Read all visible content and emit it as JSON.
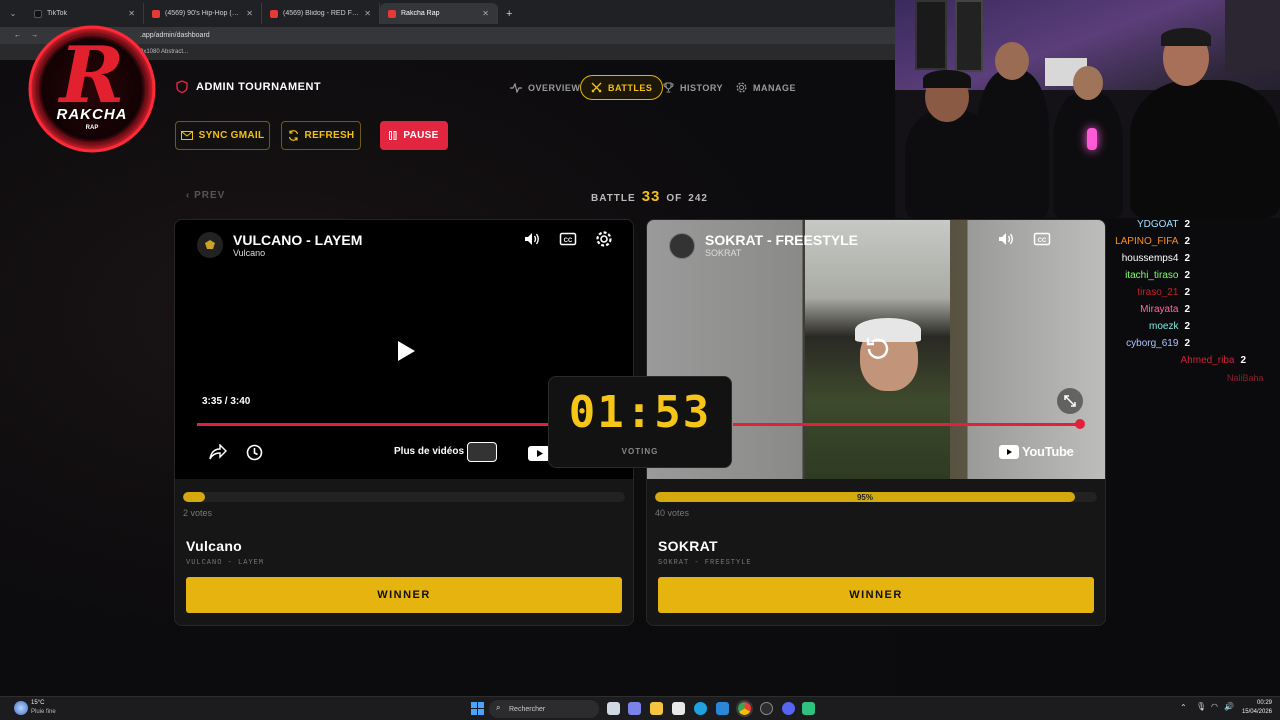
{
  "browser": {
    "tabs": [
      {
        "label": "TikTok",
        "color": "#111111",
        "active": false
      },
      {
        "label": "(4569) 90's Hip-Hop (1994) [Lo...",
        "color": "#e53935",
        "active": false
      },
      {
        "label": "(4569) Blidog - RED FLAG (Offi...",
        "color": "#e53935",
        "active": false
      },
      {
        "label": "Rakcha Rap",
        "color": "#e53935",
        "active": true
      }
    ],
    "new_tab": "+",
    "url": ".app/admin/dashboard",
    "bookmark": "0x1080 Abstract..."
  },
  "logo": {
    "text": "RAKCHA",
    "sub": "RAP",
    "letter": "R"
  },
  "header": {
    "title": "ADMIN TOURNAMENT",
    "nav": [
      {
        "label": "OVERVIEW",
        "icon": "activity-icon"
      },
      {
        "label": "BATTLES",
        "icon": "swords-icon"
      },
      {
        "label": "HISTORY",
        "icon": "trophy-icon"
      },
      {
        "label": "MANAGE",
        "icon": "gear-icon"
      }
    ]
  },
  "actions": {
    "sync": "SYNC GMAIL",
    "refresh": "REFRESH",
    "pause": "PAUSE"
  },
  "battle": {
    "prev": "PREV",
    "label": "BATTLE",
    "current": "33",
    "of": "OF",
    "total": "242"
  },
  "left": {
    "video_title": "VULCANO - LAYEM",
    "channel": "Vulcano",
    "time": "3:35 / 3:40",
    "more": "Plus de vidéos",
    "vote_pct": 5,
    "vote_label": "",
    "votes": "2 votes",
    "name": "Vulcano",
    "sub": "VULCANO - LAYEM",
    "winner": "WINNER"
  },
  "right": {
    "video_title": "SOKRAT - FREESTYLE",
    "channel": "SOKRAT",
    "youtube": "YouTube",
    "vote_pct": 95,
    "vote_label": "95%",
    "votes": "40 votes",
    "name": "SOKRAT",
    "sub": "SOKRAT - FREESTYLE",
    "winner": "WINNER"
  },
  "timer": {
    "value": "01:53",
    "label": "VOTING"
  },
  "chat": [
    {
      "user": "YDGOAT",
      "count": "2",
      "color": "#9fe0ff"
    },
    {
      "user": "LAPINO_FIFA",
      "count": "2",
      "color": "#ff8c1a"
    },
    {
      "user": "houssemps4",
      "count": "2",
      "color": "#ffffff"
    },
    {
      "user": "itachi_tiraso",
      "count": "2",
      "color": "#7cff6a"
    },
    {
      "user": "tiraso_21",
      "count": "2",
      "color": "#c0202a"
    },
    {
      "user": "Mirayata",
      "count": "2",
      "color": "#ff6b9a"
    },
    {
      "user": "moezk",
      "count": "2",
      "color": "#7ee8e0"
    },
    {
      "user": "cyborg_619",
      "count": "2",
      "color": "#b0c4ff"
    },
    {
      "user": "Ahmed_riba",
      "count": "2",
      "color": "#d0203a"
    }
  ],
  "chat_extra": "NaliBaha",
  "taskbar": {
    "weather_temp": "15°C",
    "weather_desc": "Pluie fine",
    "search": "Rechercher",
    "clock_time": "00:29",
    "clock_date": "15/04/2026"
  }
}
